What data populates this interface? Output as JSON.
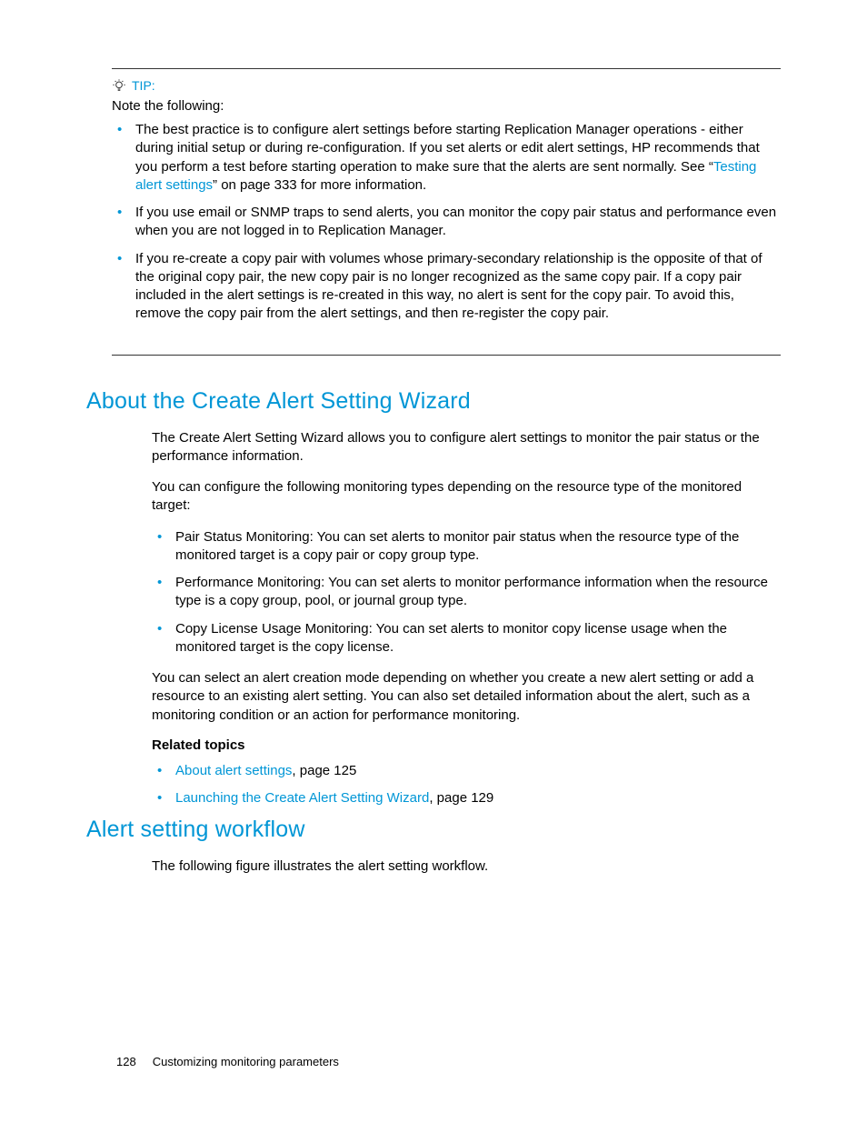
{
  "tip": {
    "label": "TIP:",
    "note_following": "Note the following:",
    "items": [
      {
        "pre": "The best practice is to configure alert settings before starting Replication Manager operations - either during initial setup or during re-configuration. If you set alerts or edit alert settings, HP recommends that you perform a test before starting operation to make sure that the alerts are sent normally. See “",
        "link": "Testing alert settings",
        "post": "” on page 333 for more information."
      },
      {
        "text": "If you use email or SNMP traps to send alerts, you can monitor the copy pair status and performance even when you are not logged in to Replication Manager."
      },
      {
        "text": "If you re-create a copy pair with volumes whose primary-secondary relationship is the opposite of that of the original copy pair, the new copy pair is no longer recognized as the same copy pair. If a copy pair included in the alert settings is re-created in this way, no alert is sent for the copy pair. To avoid this, remove the copy pair from the alert settings, and then re-register the copy pair."
      }
    ]
  },
  "section1": {
    "heading": "About the Create Alert Setting Wizard",
    "para1": "The Create Alert Setting Wizard allows you to configure alert settings to monitor the pair status or the performance information.",
    "para2": "You can configure the following monitoring types depending on the resource type of the monitored target:",
    "bullets": [
      "Pair Status Monitoring: You can set alerts to monitor pair status when the resource type of the monitored target is a copy pair or copy group type.",
      "Performance Monitoring: You can set alerts to monitor performance information when the resource type is a copy group, pool, or journal group type.",
      "Copy License Usage Monitoring: You can set alerts to monitor copy license usage when the monitored target is the copy license."
    ],
    "para3": "You can select an alert creation mode depending on whether you create a new alert setting or add a resource to an existing alert setting. You can also set detailed information about the alert, such as a monitoring condition or an action for performance monitoring.",
    "related_label": "Related topics",
    "related": [
      {
        "link": "About alert settings",
        "suffix": ", page 125"
      },
      {
        "link": "Launching the Create Alert Setting Wizard",
        "suffix": ", page 129"
      }
    ]
  },
  "section2": {
    "heading": "Alert setting workflow",
    "para1": "The following figure illustrates the alert setting workflow."
  },
  "footer": {
    "page": "128",
    "title": "Customizing monitoring parameters"
  }
}
